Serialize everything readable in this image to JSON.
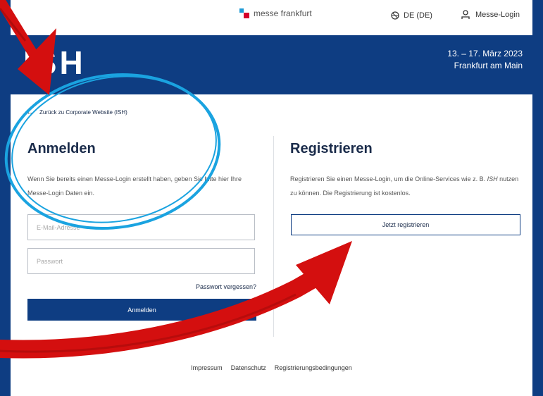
{
  "topbar": {
    "brand": "messe frankfurt",
    "language": "DE (DE)",
    "login": "Messe-Login"
  },
  "event": {
    "logo": "ISH",
    "date": "13. – 17. März 2023",
    "location": "Frankfurt am Main"
  },
  "back_link": "Zurück zu Corporate Website (ISH)",
  "login_section": {
    "title": "Anmelden",
    "description": "Wenn Sie bereits einen Messe-Login erstellt haben, geben Sie bitte hier Ihre Messe-Login Daten ein.",
    "email_placeholder": "E-Mail-Adresse",
    "password_placeholder": "Passwort",
    "forgot_password": "Passwort vergessen?",
    "submit": "Anmelden"
  },
  "register_section": {
    "title": "Registrieren",
    "description_before": "Registrieren Sie einen Messe-Login, um die Online-Services wie z. B. ",
    "description_italic": "ISH",
    "description_after": " nutzen zu können. Die Registrierung ist kostenlos.",
    "button": "Jetzt registrieren"
  },
  "footer": {
    "links": [
      "Impressum",
      "Datenschutz",
      "Registrierungsbedingungen"
    ]
  },
  "colors": {
    "brand_blue": "#0e3d82",
    "annotation_red": "#d40f0f",
    "annotation_cyan": "#1aa3e0"
  },
  "icons": [
    "globe-icon",
    "user-icon",
    "arrow-left-icon"
  ]
}
